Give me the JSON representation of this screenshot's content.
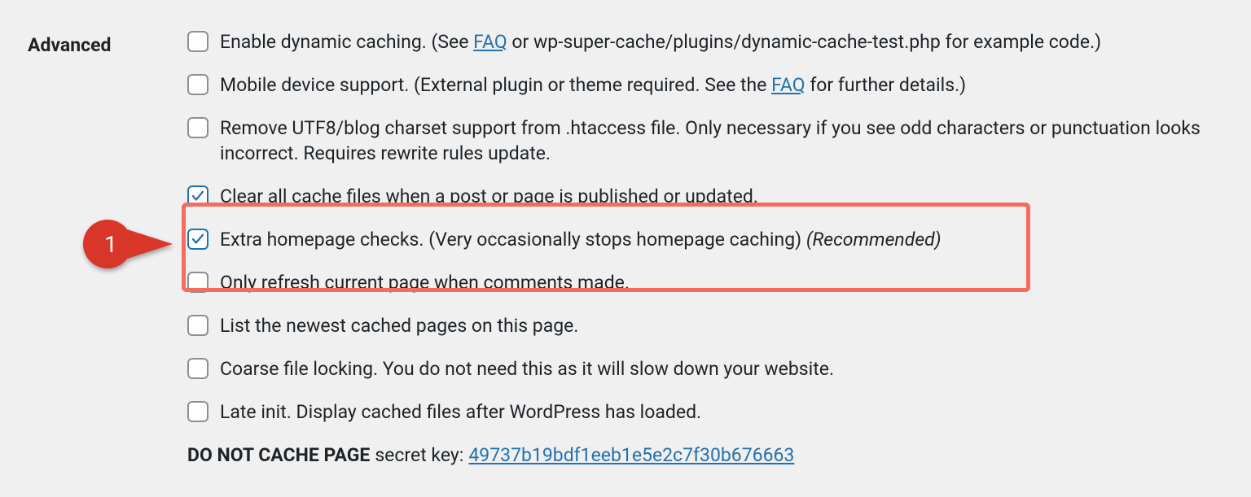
{
  "section_label": "Advanced",
  "callout_number": "1",
  "options": {
    "dynamic_caching": {
      "checked": false,
      "pre": "Enable dynamic caching. (See ",
      "link": "FAQ",
      "post": " or wp-super-cache/plugins/dynamic-cache-test.php for example code.)"
    },
    "mobile_support": {
      "checked": false,
      "pre": "Mobile device support. (External plugin or theme required. See the ",
      "link": "FAQ",
      "post": " for further details.)"
    },
    "remove_utf8": {
      "checked": false,
      "text": "Remove UTF8/blog charset support from .htaccess file. Only necessary if you see odd characters or punctuation looks incorrect. Requires rewrite rules update."
    },
    "clear_all": {
      "checked": true,
      "text": "Clear all cache files when a post or page is published or updated."
    },
    "extra_homepage": {
      "checked": true,
      "text": "Extra homepage checks. (Very occasionally stops homepage caching) ",
      "rec": "(Recommended)"
    },
    "only_refresh": {
      "checked": false,
      "text": "Only refresh current page when comments made."
    },
    "list_newest": {
      "checked": false,
      "text": "List the newest cached pages on this page."
    },
    "coarse_lock": {
      "checked": false,
      "text": "Coarse file locking. You do not need this as it will slow down your website."
    },
    "late_init": {
      "checked": false,
      "text": "Late init. Display cached files after WordPress has loaded."
    },
    "secret": {
      "label": "DO NOT CACHE PAGE",
      "mid": " secret key: ",
      "value": "49737b19bdf1eeb1e5e2c7f30b676663"
    }
  }
}
